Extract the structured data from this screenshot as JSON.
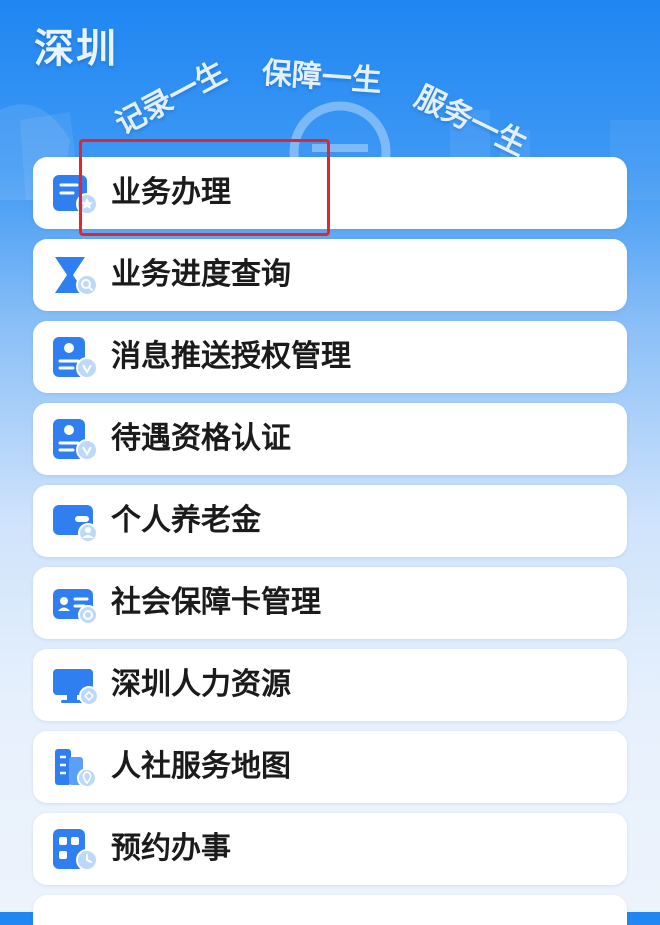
{
  "header": {
    "city": "深圳",
    "slogans": [
      "记录一生",
      "保障一生",
      "服务一生"
    ]
  },
  "menu": {
    "items": [
      {
        "label": "业务办理",
        "icon": "business-handling-icon"
      },
      {
        "label": "业务进度查询",
        "icon": "progress-search-icon"
      },
      {
        "label": "消息推送授权管理",
        "icon": "message-authorization-icon"
      },
      {
        "label": "待遇资格认证",
        "icon": "qualification-certification-icon"
      },
      {
        "label": "个人养老金",
        "icon": "pension-card-icon"
      },
      {
        "label": "社会保障卡管理",
        "icon": "social-security-card-icon"
      },
      {
        "label": "深圳人力资源",
        "icon": "computer-monitor-icon"
      },
      {
        "label": "人社服务地图",
        "icon": "service-map-icon"
      },
      {
        "label": "预约办事",
        "icon": "appointment-clock-icon"
      }
    ]
  },
  "colors": {
    "accent": "#2f7ff0",
    "icon_light": "#bcd8fb",
    "highlight": "#e3262b"
  }
}
